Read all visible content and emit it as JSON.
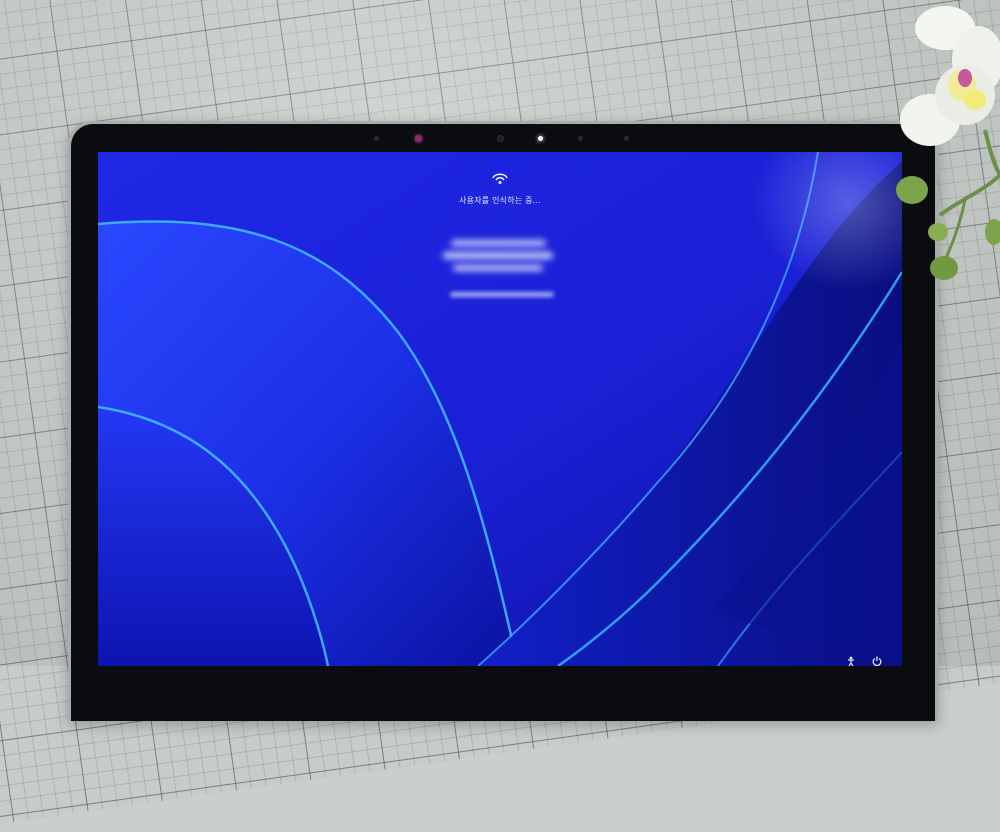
{
  "lock_screen": {
    "status_text": "사용자를 인식하는 중...",
    "face_icon": "face-recognition-icon"
  },
  "tray": {
    "icons": [
      "accessibility-icon",
      "power-icon"
    ]
  },
  "colors": {
    "screen_base": "#1d22e0",
    "ribbon_light": "#3fb7ff",
    "ribbon_dark": "#0a14a8"
  }
}
